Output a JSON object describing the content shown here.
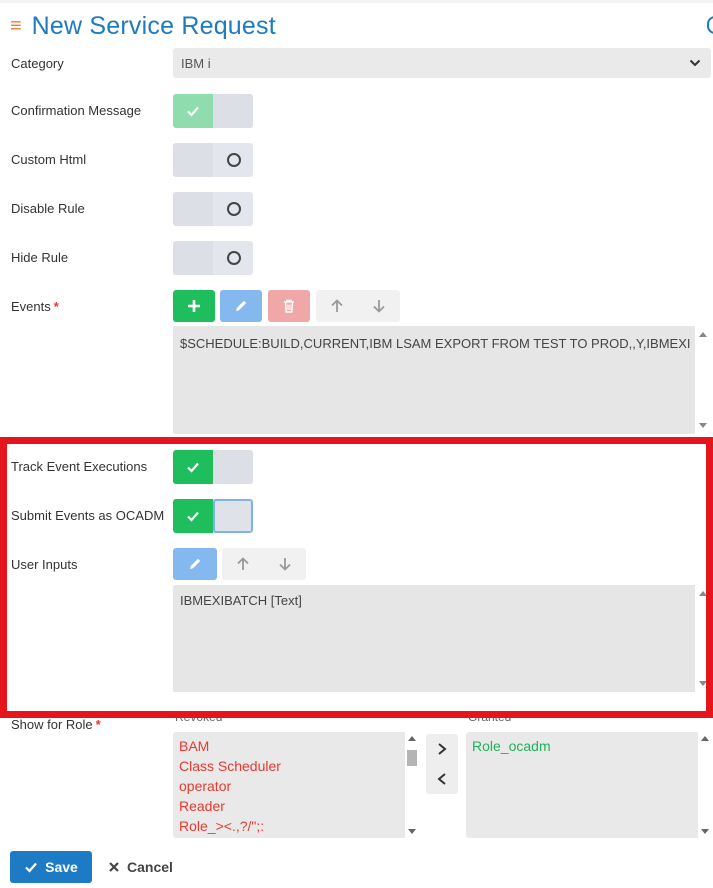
{
  "header": {
    "title": "New Service Request",
    "menu_icon": "hamburger-icon"
  },
  "fields": {
    "category": {
      "label": "Category",
      "value": "IBM i"
    },
    "confirmation_message": {
      "label": "Confirmation Message",
      "on": true
    },
    "custom_html": {
      "label": "Custom Html",
      "on": false
    },
    "disable_rule": {
      "label": "Disable Rule",
      "on": false
    },
    "hide_rule": {
      "label": "Hide Rule",
      "on": false
    },
    "events": {
      "label": "Events",
      "required_mark": "*",
      "value": "$SCHEDULE:BUILD,CURRENT,IBM LSAM EXPORT FROM TEST TO PROD,,Y,IBMEXI"
    },
    "track_event_executions": {
      "label": "Track Event Executions",
      "on": true
    },
    "submit_events_as_ocadm": {
      "label": "Submit Events as OCADM",
      "on": true
    },
    "user_inputs": {
      "label": "User Inputs",
      "value": "IBMEXIBATCH [Text]"
    },
    "show_for_role": {
      "label": "Show for Role",
      "required_mark": "*",
      "revoked_label": "Revoked",
      "granted_label": "Granted",
      "revoked": [
        "BAM",
        "Class Scheduler",
        "operator",
        "Reader",
        "Role_><.,?/\";:"
      ],
      "granted": [
        "Role_ocadm"
      ]
    }
  },
  "actions": {
    "save": "Save",
    "cancel": "Cancel"
  },
  "colors": {
    "accent": "#1d7bbf",
    "success": "#1ebe5c",
    "danger": "#e8392e",
    "highlight": "#e6141c"
  }
}
